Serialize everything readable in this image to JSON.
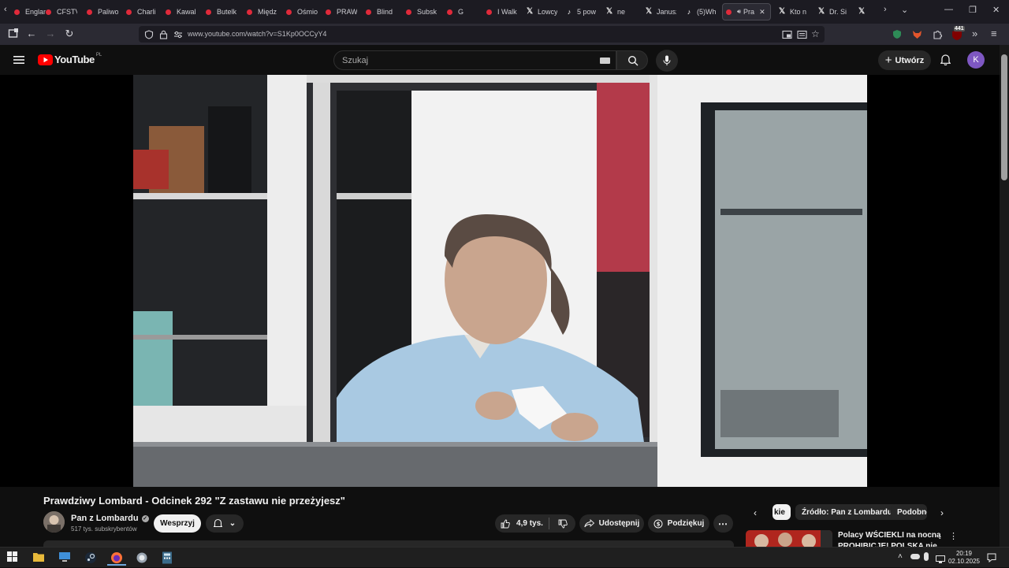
{
  "browser": {
    "tabs": [
      {
        "label": "Englan",
        "icon": "youtube-icon"
      },
      {
        "label": "CFSTV",
        "icon": "youtube-icon"
      },
      {
        "label": "Paliwo",
        "icon": "youtube-icon"
      },
      {
        "label": "Charli",
        "icon": "youtube-icon"
      },
      {
        "label": "Kawal",
        "icon": "youtube-icon"
      },
      {
        "label": "Butelk",
        "icon": "youtube-icon"
      },
      {
        "label": "Międz",
        "icon": "youtube-icon"
      },
      {
        "label": "Ośmio",
        "icon": "youtube-icon"
      },
      {
        "label": "PRAW",
        "icon": "youtube-icon"
      },
      {
        "label": "Blind",
        "icon": "youtube-icon"
      },
      {
        "label": "Subsk",
        "icon": "youtube-icon"
      },
      {
        "label": "G",
        "icon": "youtube-icon"
      },
      {
        "label": "I Walk",
        "icon": "youtube-icon"
      },
      {
        "label": "Lowcy",
        "icon": "x-icon"
      },
      {
        "label": "5 pow",
        "icon": "tiktok-icon"
      },
      {
        "label": "ne",
        "icon": "x-icon"
      },
      {
        "label": "Janusz",
        "icon": "x-icon"
      },
      {
        "label": "(5)Wh",
        "icon": "tiktok-icon"
      },
      {
        "label": "Pra",
        "icon": "youtube-icon",
        "active": true
      },
      {
        "label": "Kto n",
        "icon": "x-icon"
      },
      {
        "label": "Dr. Si",
        "icon": "x-icon"
      },
      {
        "label": "",
        "icon": "x-icon"
      }
    ],
    "url": "www.youtube.com/watch?v=S1Kp0OCCyY4",
    "badge_count": "441"
  },
  "youtube": {
    "logo_text": "YouTube",
    "region": "PL",
    "search_placeholder": "Szukaj",
    "create_label": "Utwórz",
    "avatar_letter": "K"
  },
  "video": {
    "title": "Prawdziwy Lombard - Odcinek 292 \"Z zastawu nie przeżyjesz\"",
    "channel_name": "Pan z Lombardu",
    "subscribers": "517 tys. subskrybentów",
    "support_label": "Wesprzyj",
    "likes": "4,9 tys.",
    "share_label": "Udostępnij",
    "thanks_label": "Podziękuj"
  },
  "sidebar": {
    "chips": [
      "kie",
      "Źródło: Pan z Lombardu",
      "Podobne"
    ],
    "recommended_title": "Polacy WŚCIEKLI na nocną PROHIBICJĘ! POLSKA nie"
  },
  "taskbar": {
    "time": "20:19",
    "date": "02.10.2025"
  },
  "colors": {
    "youtube_red": "#ff0000",
    "background": "#0f0f0f",
    "avatar": "#7e57c2"
  }
}
